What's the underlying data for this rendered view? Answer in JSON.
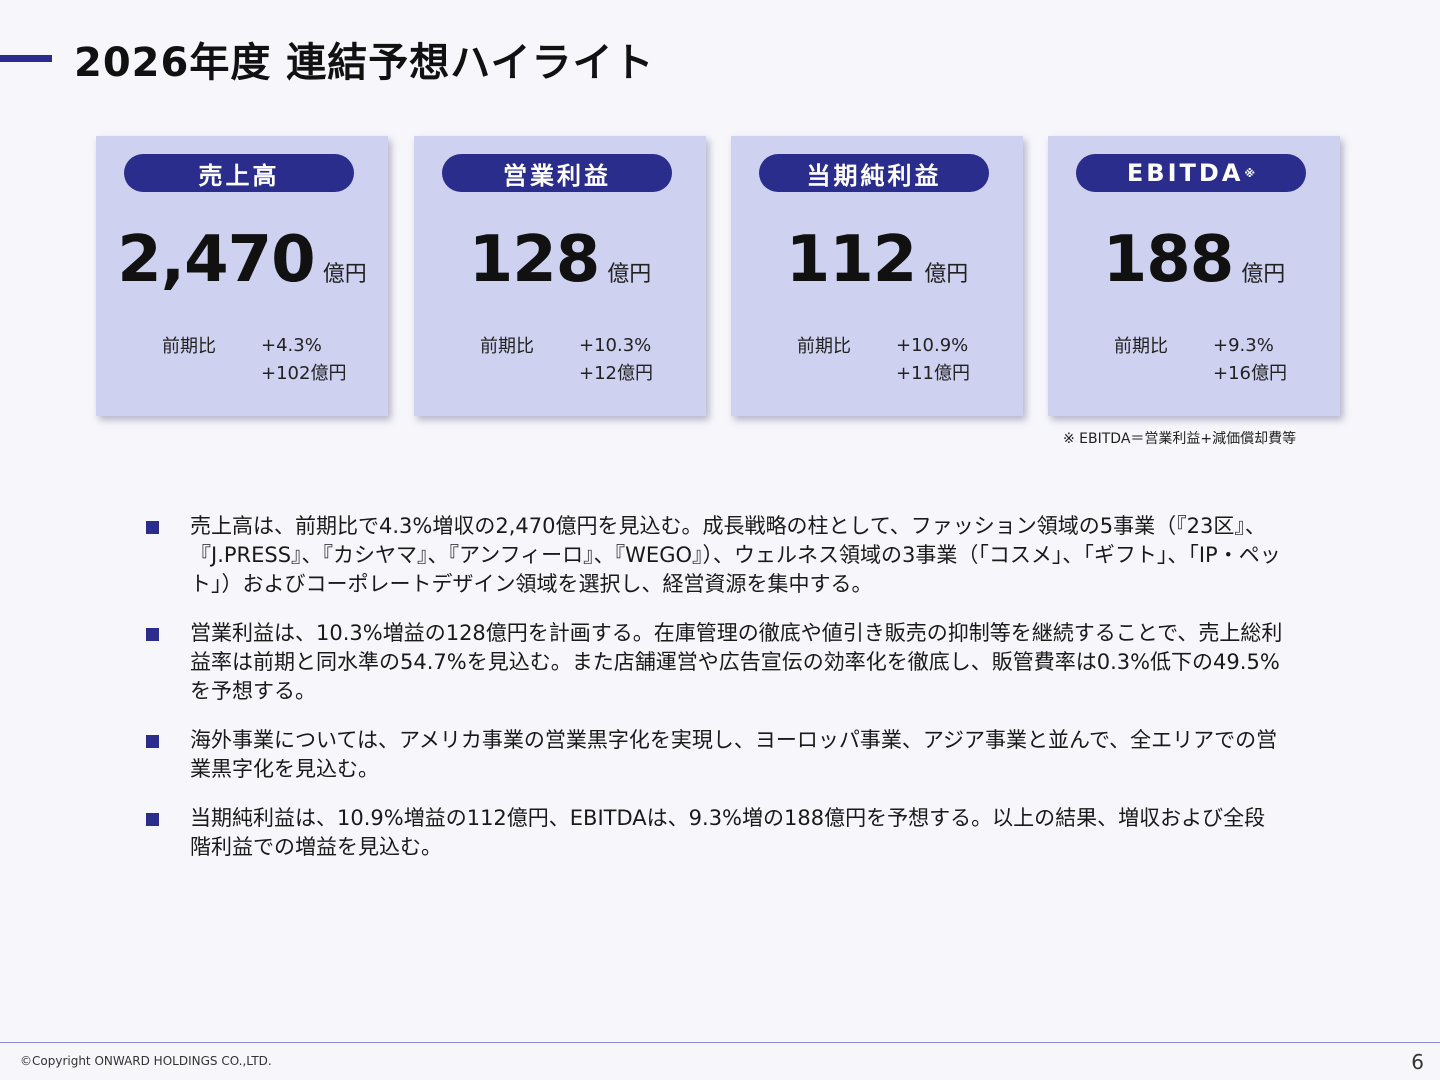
{
  "header": {
    "title": "2026年度 連結予想ハイライト"
  },
  "cards": [
    {
      "label": "売上高",
      "value": "2,470",
      "unit": "億円",
      "yoy_label": "前期比",
      "yoy_pct": "+4.3%",
      "yoy_abs": "+102億円"
    },
    {
      "label": "営業利益",
      "value": "128",
      "unit": "億円",
      "yoy_label": "前期比",
      "yoy_pct": "+10.3%",
      "yoy_abs": "+12億円"
    },
    {
      "label": "当期純利益",
      "value": "112",
      "unit": "億円",
      "yoy_label": "前期比",
      "yoy_pct": "+10.9%",
      "yoy_abs": "+11億円"
    },
    {
      "label": "EBITDA",
      "label_mark": "※",
      "value": "188",
      "unit": "億円",
      "yoy_label": "前期比",
      "yoy_pct": "+9.3%",
      "yoy_abs": "+16億円"
    }
  ],
  "note": "※ EBITDA＝営業利益+減価償却費等",
  "bullets": [
    "売上高は、前期比で4.3%増収の2,470億円を見込む。成長戦略の柱として、ファッション領域の5事業（『23区』、『J.PRESS』、『カシヤマ』、『アンフィーロ』、『WEGO』）、ウェルネス領域の3事業（「コスメ」、「ギフト」、「IP・ペット」）およびコーポレートデザイン領域を選択し、経営資源を集中する。",
    "営業利益は、10.3%増益の128億円を計画する。在庫管理の徹底や値引き販売の抑制等を継続することで、売上総利益率は前期と同水準の54.7%を見込む。また店舗運営や広告宣伝の効率化を徹底し、販管費率は0.3%低下の49.5%を予想する。",
    "海外事業については、アメリカ事業の営業黒字化を実現し、ヨーロッパ事業、アジア事業と並んで、全エリアでの営業黒字化を見込む。",
    "当期純利益は、10.9%増益の112億円、EBITDAは、9.3%増の188億円を予想する。以上の結果、増収および全段階利益での増益を見込む。"
  ],
  "footer": {
    "copyright": "©Copyright ONWARD HOLDINGS CO.,LTD.",
    "page_number": "6"
  },
  "colors": {
    "accent": "#2b2d8c",
    "card_bg": "#cfd1f0",
    "page_bg": "#f6f6fb"
  }
}
